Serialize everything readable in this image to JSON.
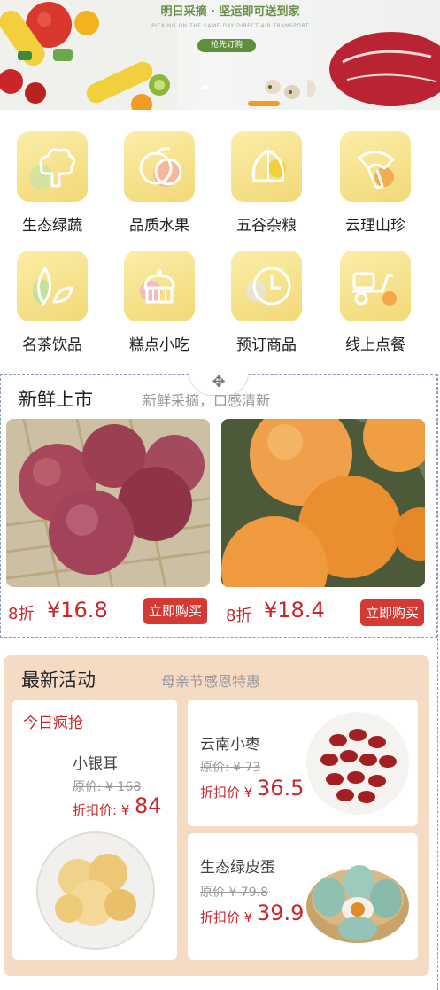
{
  "banner": {
    "title": "明日采摘 · 坚运即可送到家",
    "subtitle": "PICKING ON THE SAME DAY DIRECT AIR TRANSPORT",
    "button_label": "抢先订购"
  },
  "categories": [
    {
      "label": "生态绿蔬",
      "icon": "vegetable-icon"
    },
    {
      "label": "品质水果",
      "icon": "fruit-icon"
    },
    {
      "label": "五谷杂粮",
      "icon": "grain-icon"
    },
    {
      "label": "云理山珍",
      "icon": "mushroom-icon"
    },
    {
      "label": "名茶饮品",
      "icon": "tea-leaf-icon"
    },
    {
      "label": "糕点小吃",
      "icon": "cake-icon"
    },
    {
      "label": "预订商品",
      "icon": "clock-icon"
    },
    {
      "label": "线上点餐",
      "icon": "scooter-icon"
    }
  ],
  "fresh": {
    "title": "新鲜上市",
    "subtitle": "新鲜采摘，口感清新",
    "move_icon": "move-icon",
    "products": [
      {
        "discount": "8折",
        "price": "¥16.8",
        "button": "立即购买"
      },
      {
        "discount": "8折",
        "price": "¥18.4",
        "button": "立即购买"
      }
    ]
  },
  "activity": {
    "title": "最新活动",
    "subtitle": "母亲节感恩特惠",
    "flash": {
      "tag": "今日疯抢",
      "name": "小银耳",
      "original": "原价: ¥ 168",
      "deal_label": "折扣价: ¥",
      "deal_price": "84"
    },
    "items": [
      {
        "name": "云南小枣",
        "original": "原价: ¥ 73",
        "deal_label": "折扣价 ¥",
        "deal_price": "36.5"
      },
      {
        "name": "生态绿皮蛋",
        "original": "原价 ¥ 79.8",
        "deal_label": "折扣价 ¥",
        "deal_price": "39.9"
      }
    ]
  },
  "colors": {
    "accent_red": "#c9262b",
    "tile_yellow": "#f2d877",
    "activity_bg": "#f6dbc4"
  }
}
